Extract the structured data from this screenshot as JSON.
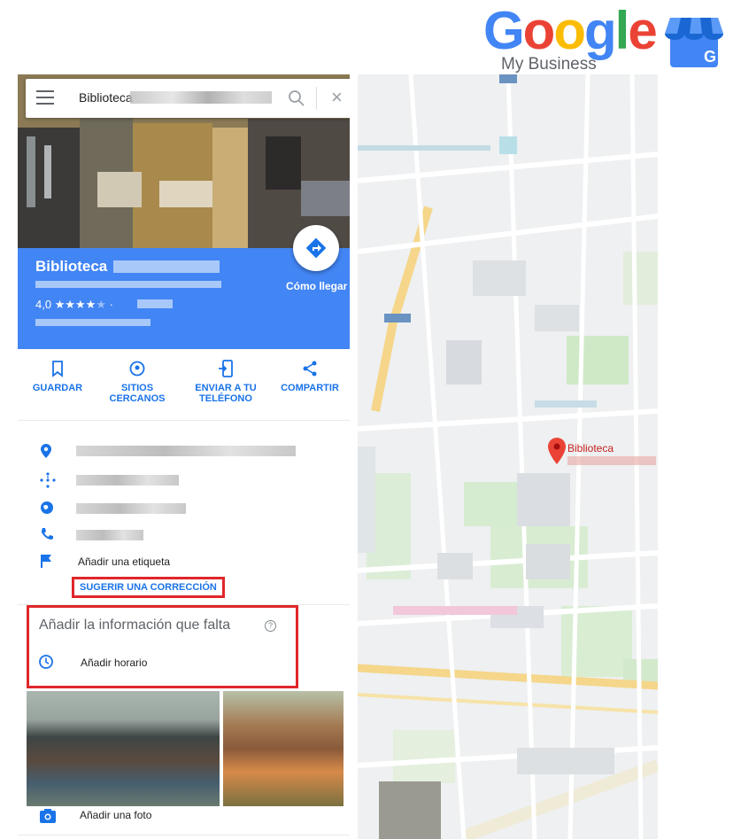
{
  "logo": {
    "letters": [
      "G",
      "o",
      "o",
      "g",
      "l",
      "e"
    ],
    "colors": [
      "#4285f4",
      "#ea4335",
      "#fbbc05",
      "#4285f4",
      "#34a853",
      "#ea4335"
    ],
    "subtitle": "My Business",
    "store_icon_letter": "G"
  },
  "search": {
    "query": "Biblioteca",
    "icons": [
      "menu-icon",
      "search-icon",
      "close-icon"
    ],
    "close_glyph": "×"
  },
  "place": {
    "name": "Biblioteca",
    "rating": "4,0",
    "stars": "★★★★",
    "star_empty": "★",
    "dot": "·",
    "directions_label": "Cómo llegar"
  },
  "actions": [
    {
      "label": "GUARDAR",
      "icon": "bookmark-icon"
    },
    {
      "label": "SITIOS\nCERCANOS",
      "icon": "nearby-icon"
    },
    {
      "label": "ENVIAR A TU\nTELÉFONO",
      "icon": "send-to-phone-icon"
    },
    {
      "label": "COMPARTIR",
      "icon": "share-icon"
    }
  ],
  "details": {
    "add_label": "Añadir una etiqueta",
    "suggest_edit": "SUGERIR UNA CORRECCIÓN"
  },
  "missing": {
    "title": "Añadir la información que falta",
    "help_glyph": "?",
    "add_hours": "Añadir horario"
  },
  "add_photo": "Añadir una foto",
  "map": {
    "marker_label": "Biblioteca"
  },
  "colors": {
    "accent_blue": "#4285f4",
    "link_blue": "#1a73e8",
    "highlight_red": "#e0262a",
    "marker_red": "#ea4335"
  }
}
